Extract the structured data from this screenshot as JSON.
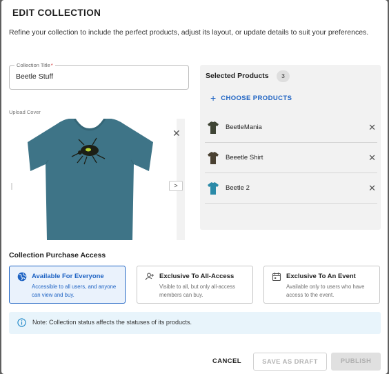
{
  "dialog": {
    "title": "EDIT COLLECTION",
    "subtitle": "Refine your collection to include the perfect products, adjust its layout, or update details to suit your preferences."
  },
  "collection_title": {
    "label": "Collection Title",
    "required_mark": "*",
    "value": "Beetle Stuff"
  },
  "upload": {
    "label": "Upload Cover",
    "image": "teal-tshirt-with-beetle-print"
  },
  "selected_products": {
    "title": "Selected Products",
    "count": "3",
    "choose_label": "CHOOSE PRODUCTS",
    "items": [
      {
        "name": "BeetleMania",
        "thumb_color": "#3f4535"
      },
      {
        "name": "Beeetle Shirt",
        "thumb_color": "#4a4132"
      },
      {
        "name": "Beetle 2",
        "thumb_color": "#2b8aa8"
      }
    ]
  },
  "access": {
    "title": "Collection Purchase Access",
    "options": [
      {
        "title": "Available For Everyone",
        "desc": "Accessible to all users, and anyone can view and buy.",
        "icon": "globe-icon",
        "selected": true
      },
      {
        "title": "Exclusive To All-Access",
        "desc": "Visible to all, but only all-access members can buy.",
        "icon": "person-add-icon",
        "selected": false
      },
      {
        "title": "Exclusive To An Event",
        "desc": "Available only to users who have access to the event.",
        "icon": "calendar-icon",
        "selected": false
      }
    ]
  },
  "note": {
    "text": "Note: Collection status affects the statuses of its products."
  },
  "actions": {
    "cancel": "CANCEL",
    "save_draft": "SAVE AS DRAFT",
    "publish": "PUBLISH"
  },
  "colors": {
    "accent": "#1e63c3",
    "note_bg": "#e8f4fb",
    "shirt": "#3e7487"
  }
}
